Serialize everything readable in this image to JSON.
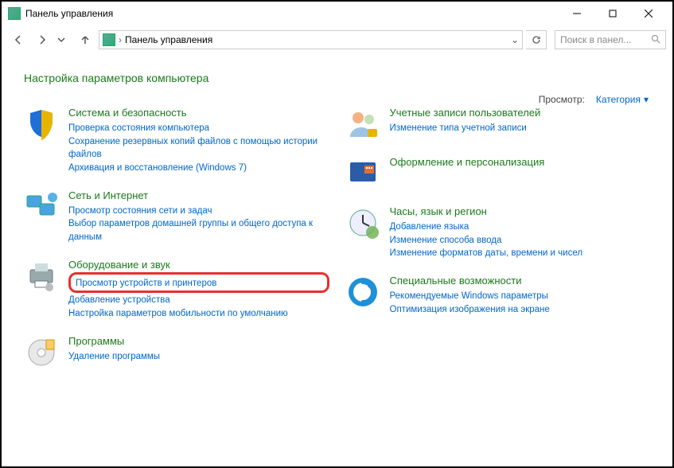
{
  "window": {
    "title": "Панель управления"
  },
  "path": {
    "root": "Панель управления"
  },
  "search": {
    "placeholder": "Поиск в панел..."
  },
  "heading": "Настройка параметров компьютера",
  "view": {
    "label": "Просмотр:",
    "value": "Категория"
  },
  "left": [
    {
      "title": "Система и безопасность",
      "links": [
        "Проверка состояния компьютера",
        "Сохранение резервных копий файлов с помощью истории файлов",
        "Архивация и восстановление (Windows 7)"
      ]
    },
    {
      "title": "Сеть и Интернет",
      "links": [
        "Просмотр состояния сети и задач",
        "Выбор параметров домашней группы и общего доступа к данным"
      ]
    },
    {
      "title": "Оборудование и звук",
      "links": [
        "Просмотр устройств и принтеров",
        "Добавление устройства",
        "Настройка параметров мобильности по умолчанию"
      ],
      "highlight": 0
    },
    {
      "title": "Программы",
      "links": [
        "Удаление программы"
      ]
    }
  ],
  "right": [
    {
      "title": "Учетные записи пользователей",
      "links": [
        "Изменение типа учетной записи"
      ]
    },
    {
      "title": "Оформление и персонализация",
      "links": []
    },
    {
      "title": "Часы, язык и регион",
      "links": [
        "Добавление языка",
        "Изменение способа ввода",
        "Изменение форматов даты, времени и чисел"
      ]
    },
    {
      "title": "Специальные возможности",
      "links": [
        "Рекомендуемые Windows параметры",
        "Оптимизация изображения на экране"
      ]
    }
  ]
}
